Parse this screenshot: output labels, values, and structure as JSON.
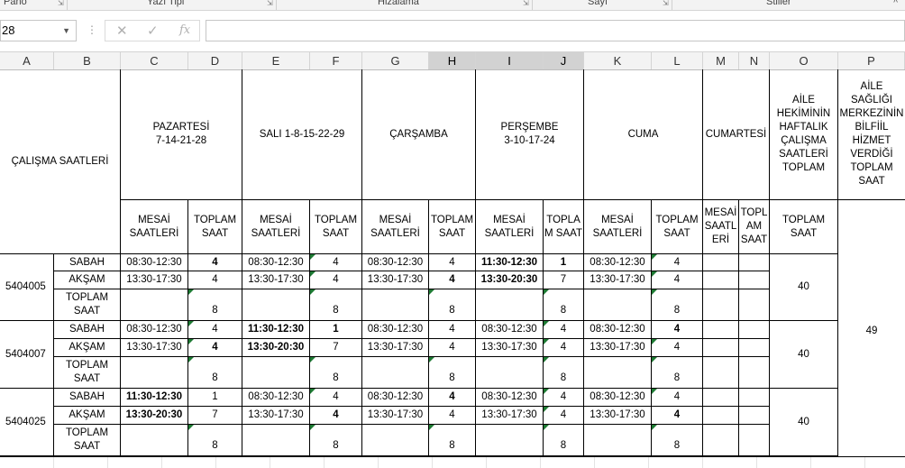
{
  "ribbon": {
    "groups": [
      "Pano",
      "Yazı Tipi",
      "Hizalama",
      "Sayı",
      "Stiller"
    ],
    "collapse": "^"
  },
  "formula_bar": {
    "name_box": "28",
    "formula": "",
    "cancel_icon": "✕",
    "enter_icon": "✓",
    "fx_icon": "fx"
  },
  "columns": [
    "A",
    "B",
    "C",
    "D",
    "E",
    "F",
    "G",
    "H",
    "I",
    "J",
    "K",
    "L",
    "M",
    "N",
    "O",
    "P"
  ],
  "selected_columns": [
    "H",
    "I",
    "J"
  ],
  "header": {
    "calisma_saatleri": "ÇALIŞMA SAATLERİ",
    "days": [
      {
        "line1": "PAZARTESİ",
        "line2": "7-14-21-28"
      },
      {
        "line1": "SALI 1-8-15-22-29",
        "line2": ""
      },
      {
        "line1": "ÇARŞAMBA",
        "line2": ""
      },
      {
        "line1": "PERŞEMBE",
        "line2": "3-10-17-24"
      },
      {
        "line1": "CUMA",
        "line2": ""
      },
      {
        "line1": "CUMARTESİ",
        "line2": ""
      }
    ],
    "aile_hekimi": [
      "AİLE",
      "HEKİMİNİN",
      "HAFTALIK",
      "ÇALIŞMA",
      "SAATLERİ",
      "TOPLAM"
    ],
    "asm": [
      "AİLE SAĞLIĞI",
      "MERKEZİNİN",
      "BİLFİİL",
      "HİZMET",
      "VERDİĞİ",
      "TOPLAM",
      "SAAT"
    ],
    "mesai": [
      "MESAİ",
      "SAATLERİ"
    ],
    "toplam": [
      "TOPLAM",
      "SAAT"
    ],
    "topla_m_saat": [
      "TOPLA",
      "M SAAT"
    ],
    "mesai_sat": [
      "MESAİ",
      "SAATL",
      "ERİ"
    ],
    "topl_am_saat": [
      "TOPL",
      "AM",
      "SAAT"
    ],
    "o_toplam": [
      "TOPLAM",
      "SAAT"
    ]
  },
  "groups": [
    {
      "id": "5404005",
      "weekly_total": "40",
      "rows": [
        {
          "label": "SABAH",
          "mon": [
            "08:30-12:30",
            "4"
          ],
          "tue": [
            "08:30-12:30",
            "4"
          ],
          "wed": [
            "08:30-12:30",
            "4"
          ],
          "thu": [
            "11:30-12:30",
            "1"
          ],
          "fri": [
            "08:30-12:30",
            "4"
          ]
        },
        {
          "label": "AKŞAM",
          "mon": [
            "13:30-17:30",
            "4"
          ],
          "tue": [
            "13:30-17:30",
            "4"
          ],
          "wed": [
            "13:30-17:30",
            "4"
          ],
          "thu": [
            "13:30-20:30",
            "7"
          ],
          "fri": [
            "13:30-17:30",
            "4"
          ]
        },
        {
          "label": "TOPLAM SAAT",
          "totals": [
            "8",
            "8",
            "8",
            "8",
            "8"
          ]
        }
      ]
    },
    {
      "id": "5404007",
      "weekly_total": "40",
      "rows": [
        {
          "label": "SABAH",
          "mon": [
            "08:30-12:30",
            "4"
          ],
          "tue": [
            "11:30-12:30",
            "1"
          ],
          "wed": [
            "08:30-12:30",
            "4"
          ],
          "thu": [
            "08:30-12:30",
            "4"
          ],
          "fri": [
            "08:30-12:30",
            "4"
          ]
        },
        {
          "label": "AKŞAM",
          "mon": [
            "13:30-17:30",
            "4"
          ],
          "tue": [
            "13:30-20:30",
            "7"
          ],
          "wed": [
            "13:30-17:30",
            "4"
          ],
          "thu": [
            "13:30-17:30",
            "4"
          ],
          "fri": [
            "13:30-17:30",
            "4"
          ]
        },
        {
          "label": "TOPLAM SAAT",
          "totals": [
            "8",
            "8",
            "8",
            "8",
            "8"
          ]
        }
      ]
    },
    {
      "id": "5404025",
      "weekly_total": "40",
      "rows": [
        {
          "label": "SABAH",
          "mon": [
            "11:30-12:30",
            "1"
          ],
          "tue": [
            "08:30-12:30",
            "4"
          ],
          "wed": [
            "08:30-12:30",
            "4"
          ],
          "thu": [
            "08:30-12:30",
            "4"
          ],
          "fri": [
            "08:30-12:30",
            "4"
          ]
        },
        {
          "label": "AKŞAM",
          "mon": [
            "13:30-20:30",
            "7"
          ],
          "tue": [
            "13:30-17:30",
            "4"
          ],
          "wed": [
            "13:30-17:30",
            "4"
          ],
          "thu": [
            "13:30-17:30",
            "4"
          ],
          "fri": [
            "13:30-17:30",
            "4"
          ]
        },
        {
          "label": "TOPLAM SAAT",
          "totals": [
            "8",
            "8",
            "8",
            "8",
            "8"
          ]
        }
      ]
    }
  ],
  "asm_total": "49",
  "colors": {
    "selected_header": "#d2d2d2",
    "error_triangle": "#1e7b34",
    "header_bg": "#f3f3f3"
  }
}
